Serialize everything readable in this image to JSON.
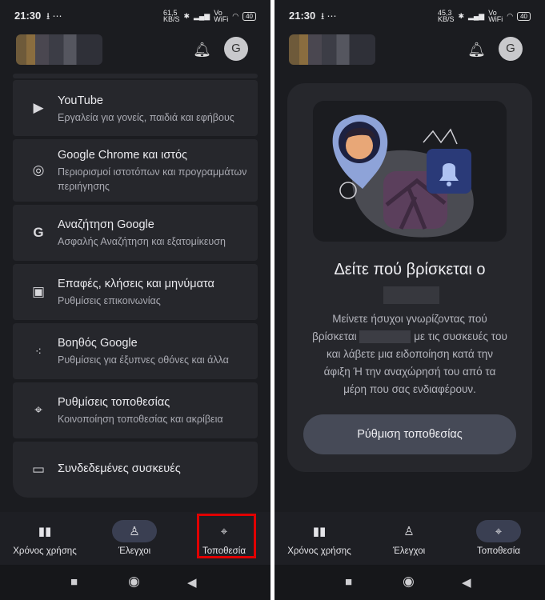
{
  "status_bar": {
    "time": "21:30",
    "left_extra": "⭳ ⋯",
    "left_speed": "61,5\nKB/S",
    "right_speed": "45,3\nKB/S",
    "volte": "Vo\nWiFi",
    "battery": "40"
  },
  "app_bar": {
    "avatar_letter": "G"
  },
  "settings_list": [
    {
      "title": "YouTube",
      "subtitle": "Εργαλεία για γονείς, παιδιά και εφήβους",
      "icon": "youtube-icon"
    },
    {
      "title": "Google Chrome και ιστός",
      "subtitle": "Περιορισμοί ιστοτόπων και προγραμμάτων περιήγησης",
      "icon": "chrome-icon"
    },
    {
      "title": "Αναζήτηση Google",
      "subtitle": "Ασφαλής Αναζήτηση και εξατομίκευση",
      "icon": "google-icon"
    },
    {
      "title": "Επαφές, κλήσεις και μηνύματα",
      "subtitle": "Ρυθμίσεις επικοινωνίας",
      "icon": "contacts-icon"
    },
    {
      "title": "Βοηθός Google",
      "subtitle": "Ρυθμίσεις για έξυπνες οθόνες και άλλα",
      "icon": "assistant-icon"
    },
    {
      "title": "Ρυθμίσεις τοποθεσίας",
      "subtitle": "Κοινοποίηση τοποθεσίας και ακρίβεια",
      "icon": "location-pin-icon"
    },
    {
      "title": "Συνδεδεμένες συσκευές",
      "subtitle": "",
      "icon": "devices-icon"
    }
  ],
  "location_panel": {
    "heading": "Δείτε πού βρίσκεται ο",
    "description": "Μείνετε ήσυχοι γνωρίζοντας πού βρίσκεται ░░░░░░ με τις συσκευές του και λάβετε μια ειδοποίηση κατά την άφιξη Ή την αναχώρησή του από τα μέρη που σας ενδιαφέρουν.",
    "description_parts": [
      "Μείνετε ήσυχοι γνωρίζοντας πού",
      "βρίσκεται",
      "με τις συσκευές του",
      "και λάβετε μια ειδοποίηση κατά την",
      "άφιξη Ή την αναχώρησή του από τα",
      "μέρη που σας ενδιαφέρουν."
    ],
    "button_label": "Ρύθμιση τοποθεσίας"
  },
  "bottom_nav": [
    {
      "label": "Χρόνος χρήσης",
      "icon": "bar-chart-icon"
    },
    {
      "label": "Έλεγχοι",
      "icon": "child-controls-icon"
    },
    {
      "label": "Τοποθεσία",
      "icon": "location-pin-icon"
    }
  ],
  "colors": {
    "background": "#1b1c20",
    "card": "#26272c",
    "active_pill": "#3a3f52",
    "highlight": "#e00000"
  }
}
